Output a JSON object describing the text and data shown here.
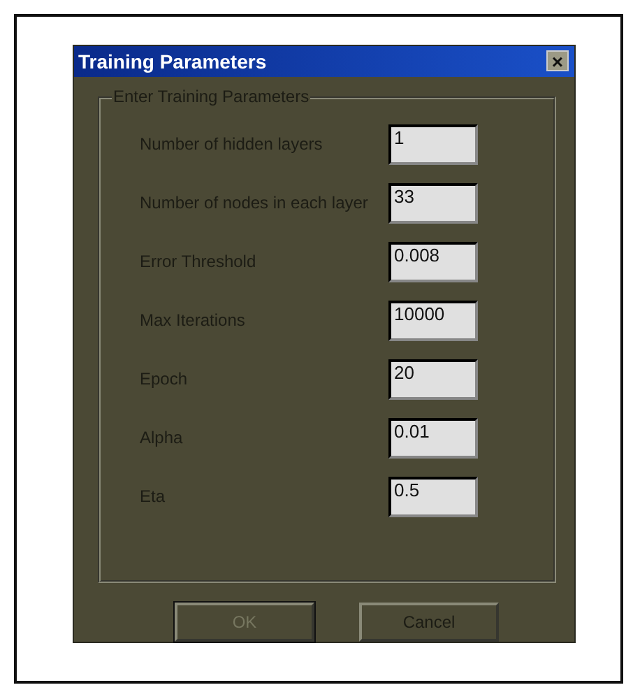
{
  "window": {
    "title": "Training Parameters",
    "close_label": "×"
  },
  "group": {
    "title": "Enter Training Parameters"
  },
  "fields": [
    {
      "label": "Number of hidden layers",
      "value": "1"
    },
    {
      "label": "Number of nodes in each layer",
      "value": "33"
    },
    {
      "label": "Error Threshold",
      "value": "0.008"
    },
    {
      "label": "Max Iterations",
      "value": "10000"
    },
    {
      "label": "Epoch",
      "value": "20"
    },
    {
      "label": "Alpha",
      "value": "0.01"
    },
    {
      "label": "Eta",
      "value": "0.5"
    }
  ],
  "buttons": [
    {
      "label": "OK",
      "default": true
    },
    {
      "label": "Cancel",
      "default": false
    }
  ]
}
